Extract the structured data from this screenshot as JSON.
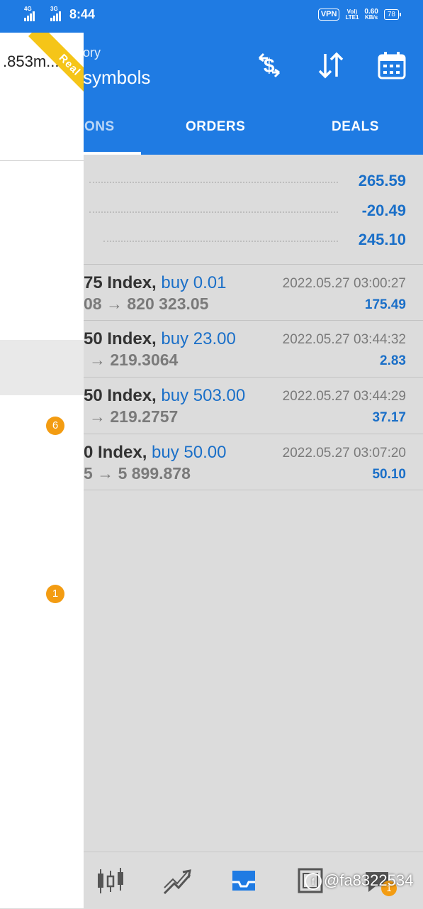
{
  "status_bar": {
    "network_1": "4G",
    "network_2": "3G",
    "time": "8:44",
    "vpn": "VPN",
    "volte_1": "Vol)",
    "volte_2": "LTE1",
    "speed_value": "0.60",
    "speed_unit": "KB/s",
    "battery": "78"
  },
  "app_bar": {
    "subtitle": "ory",
    "title": "symbols",
    "icons": [
      "currency-exchange-icon",
      "sort-icon",
      "calendar-icon"
    ]
  },
  "tabs": [
    {
      "label": "ONS",
      "active": true
    },
    {
      "label": "ORDERS",
      "active": false
    },
    {
      "label": "DEALS",
      "active": false
    }
  ],
  "summary": [
    "265.59",
    "-20.49",
    "245.10"
  ],
  "deals": [
    {
      "symbol": "75 Index,",
      "side": "buy 0.01",
      "time": "2022.05.27 03:00:27",
      "prices": "08 → 820 323.05",
      "profit": "175.49"
    },
    {
      "symbol": "50 Index,",
      "side": "buy 23.00",
      "time": "2022.05.27 03:44:32",
      "prices": "→ 219.3064",
      "profit": "2.83"
    },
    {
      "symbol": "50 Index,",
      "side": "buy 503.00",
      "time": "2022.05.27 03:44:29",
      "prices": "→ 219.2757",
      "profit": "37.17"
    },
    {
      "symbol": "0 Index,",
      "side": "buy 50.00",
      "time": "2022.05.27 03:07:20",
      "prices": "5 → 5 899.878",
      "profit": "50.10"
    }
  ],
  "drawer": {
    "account": ".853m...",
    "ribbon": "Real",
    "badge_1": "6",
    "badge_2": "1"
  },
  "bottom_nav": {
    "items": [
      "quotes-icon",
      "chart-icon",
      "trade-icon",
      "news-icon",
      "chat-icon"
    ],
    "chat_badge": "1"
  },
  "watermark": "@fa8322534",
  "colors": {
    "primary": "#1f7be3",
    "accent_blue": "#1a6fc8",
    "badge": "#f39c12",
    "ribbon": "#f5c518"
  }
}
